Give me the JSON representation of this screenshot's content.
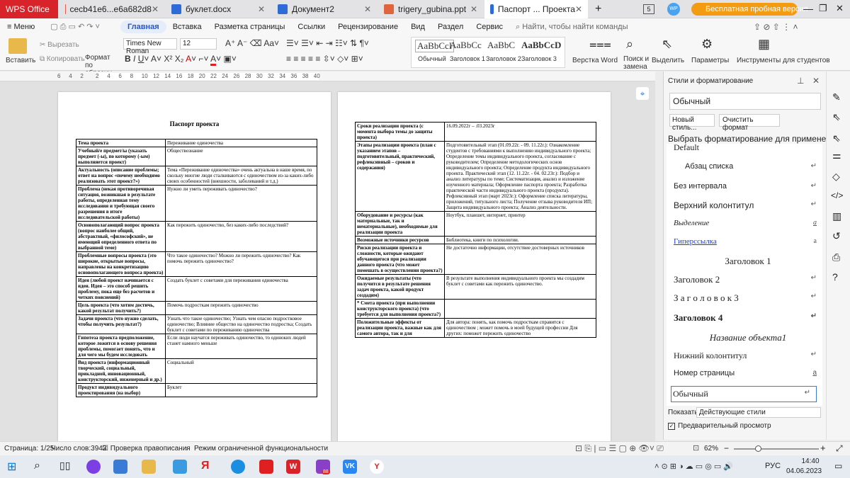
{
  "tabs": [
    {
      "label": "WPS Office"
    },
    {
      "label": "cecb41e6...e6a682d8"
    },
    {
      "label": "буклет.docx"
    },
    {
      "label": "Документ2"
    },
    {
      "label": "trigery_gubina.ppt"
    },
    {
      "label": "Паспорт ... Проекта"
    }
  ],
  "tabbar": {
    "new_tab": "+",
    "badge": "5",
    "avatar": "WP",
    "trial": "Бесплатная пробная версия"
  },
  "menu": {
    "items": [
      "Меню",
      "Главная",
      "Вставка",
      "Разметка страницы",
      "Ссылки",
      "Рецензирование",
      "Вид",
      "Раздел",
      "Сервис"
    ],
    "search": "Найти, чтобы найти команды"
  },
  "toolbar": {
    "paste": "Вставить",
    "cut": "Вырезать",
    "copy": "Копировать",
    "format_painter": "Формат по образцу",
    "font": "Times New Roman",
    "size": "12",
    "styles": [
      {
        "preview": "AaBbCcI",
        "name": "Обычный"
      },
      {
        "preview": "AaBbCc",
        "name": "Заголовок 1"
      },
      {
        "preview": "AaBbC",
        "name": "Заголовок 2"
      },
      {
        "preview": "AaBbCcD",
        "name": "Заголовок 3"
      }
    ],
    "layout": "Верстка Word",
    "find": "Поиск и замена",
    "select": "Выделить",
    "params": "Параметры",
    "tools": "Инструменты для студентов"
  },
  "ruler": [
    "6",
    "4",
    "2",
    "2",
    "4",
    "6",
    "8",
    "10",
    "12",
    "14",
    "16",
    "18",
    "20",
    "22",
    "24",
    "26",
    "28",
    "30",
    "32",
    "34",
    "36",
    "38",
    "40"
  ],
  "doc": {
    "title": "Паспорт проекта",
    "left_rows": [
      [
        "Тема проекта",
        "Переживание одиночества"
      ],
      [
        "Учебный/е предмет/ы (указать предмет (-ы), по которому (-ым) выполняется проект)",
        "Обществознание"
      ],
      [
        "Актуальность (описание проблемы; ответ на вопрос «почему необходимо реализовать этот проект?»)",
        "Тема «Переживание одиночества» очень актуальна в наше время, по скольку многие люди сталкиваются с одиночеством из-за каких-либо своих особенностей (внешности, заболеваний и т.д.)"
      ],
      [
        "Проблема (некая противоречивая ситуация, возникшая в результате работы, определенная тему исследования и требующая своего разрешения в итоге исследовательской работы)",
        "Нужно ли уметь переживать одиночество?"
      ],
      [
        "Основополагающий вопрос проекта (вопрос наиболее общий, абстрактный, «философский», не имеющий определенного ответа по выбранной теме)",
        "Как пережить одиночество, без каких-либо последствий?"
      ],
      [
        "Проблемные вопросы проекта (это широкие, открытые вопросы, направлены на конкретизацию основополагающего вопроса проекта)",
        "Что такое одиночество? Можно ли пережить одиночество? Как помочь пережить одиночество?"
      ],
      [
        "Идея (любой проект начинается с идеи. Идея – это способ решить проблему, пока еще без расчетов и четких пояснений)",
        "Создать буклет с советами для переживания одиночества"
      ],
      [
        "Цель проекта (что хотим достичь, какой результат получить?)",
        "Помочь подросткам пережить одиночество"
      ],
      [
        "Задачи проекта (что нужно сделать, чтобы получить результат?)",
        "Узнать что такое одиночество; Узнать чем опасно подростковое одиночество; Влияние общество на одиночество подростка; Создать буклет с советами по переживанию одиночества"
      ],
      [
        "Гипотеза проекта предположение, которое ложится в основу решения проблемы, помогает понять, что и для чего мы будем исследовать",
        "Если люди научатся переживать одиночество, то одиноких людей станет намного меньше"
      ],
      [
        "Вид проекта (информационный творческий, социальный, прикладной, инновационный, конструкторский, инженерный и др.)",
        "Социальный"
      ],
      [
        "Продукт индивидуального проектирования (на выбор)",
        "Буклет"
      ]
    ],
    "right_rows": [
      [
        "Сроки реализации проекта (с момента выбора темы до защиты проекта)",
        "16.09.2022г – .03.2023г"
      ],
      [
        "Этапы реализации проекта (план с указанием этапов – подготовительный, практический, рефлексивный – сроков и содержания)",
        "Подготовительный этап (01.09.22г. - 09. 11.22г.): Ознакомление студентов с требованиями к выполнению индивидуального проекта; Определение темы индивидуального проекта, согласование с руководителем; Определение методологических основ индивидуального проекта; Определение продукта индивидуального проекта. Практический этап (12. 11.22г. - 04. 02.23г.): Подбор и анализ литературы по теме; Систематизация, анализ и изложение изученного материала; Оформление паспорта проекта; Разработка практической части индивидуального проекта (продукта). Рефлексивный этап (март 2023г.): Оформление списка литературы, приложений, титульного листа; Получение отзыва руководителя ИП; Защита индивидуального проекта; Анализ деятельности."
      ],
      [
        "Оборудование и ресурсы (как материальные, так и нематериальные), необходимые для реализации проекта",
        "Ноутбук, планшет, интернет, принтер"
      ],
      [
        "Возможные источники ресурсов",
        "Библиотека, книги по психологии."
      ],
      [
        "Риски реализации проекта и сложности, которые ожидают обучающегося при реализации данного проекта (что может помешать в осуществлении проекта?)",
        "Не достаточно информации, отсутствие достоверных источников"
      ],
      [
        "Ожидаемые результаты (что получится в результате решения задач проекта, какой продукт создадим)",
        "В результате выполнения индивидуального проекта мы создадим буклет с советами как пережить одиночество."
      ],
      [
        "* Смета проекта (при выполнении конструкторского проекта) (что требуется для выполнения проекта?)",
        ""
      ],
      [
        "Положительные эффекты от реализации проекта, важные как для самого автора, так и для",
        "Для автора: понять, как помочь подросткам справится с одиночеством ; может помочь в моей будущей профессии Для других: поможет пережить одиночество"
      ]
    ]
  },
  "sidepanel": {
    "header": "Стили и форматирование",
    "current": "Обычный",
    "new_style": "Новый стиль...",
    "clear": "Очистить формат",
    "apply_label": "Выбрать форматирование для применения",
    "styles": [
      {
        "name": "Default",
        "mark": ""
      },
      {
        "name": "Абзац списка",
        "mark": "↵"
      },
      {
        "name": "Без интервала",
        "mark": "↵"
      },
      {
        "name": "Верхний колонтитул",
        "mark": "↵"
      },
      {
        "name": "Выделение",
        "mark": "a"
      },
      {
        "name": "Гиперссылка",
        "mark": "a"
      },
      {
        "name": "Заголовок 1",
        "mark": ""
      },
      {
        "name": "Заголовок 2",
        "mark": "↵"
      },
      {
        "name": "З а г о л о в о к 3",
        "mark": "↵"
      },
      {
        "name": "Заголовок 4",
        "mark": "↵"
      },
      {
        "name": "Название объекта1",
        "mark": ""
      },
      {
        "name": "Нижний колонтитул",
        "mark": "↵"
      },
      {
        "name": "Номер страницы",
        "mark": "a"
      },
      {
        "name": "Обычный",
        "mark": "↵"
      }
    ],
    "show_label": "Показать:",
    "show_value": "Действующие стили",
    "preview": "Предварительный просмотр"
  },
  "status": {
    "page": "Страница: 1/25",
    "words": "Число слов:3943",
    "spell": "Проверка правописания",
    "mode": "Режим ограниченной функциональности",
    "zoom": "62%"
  },
  "taskbar": {
    "lang": "РУС",
    "time": "14:40",
    "date": "04.06.2023",
    "badge": "88"
  }
}
